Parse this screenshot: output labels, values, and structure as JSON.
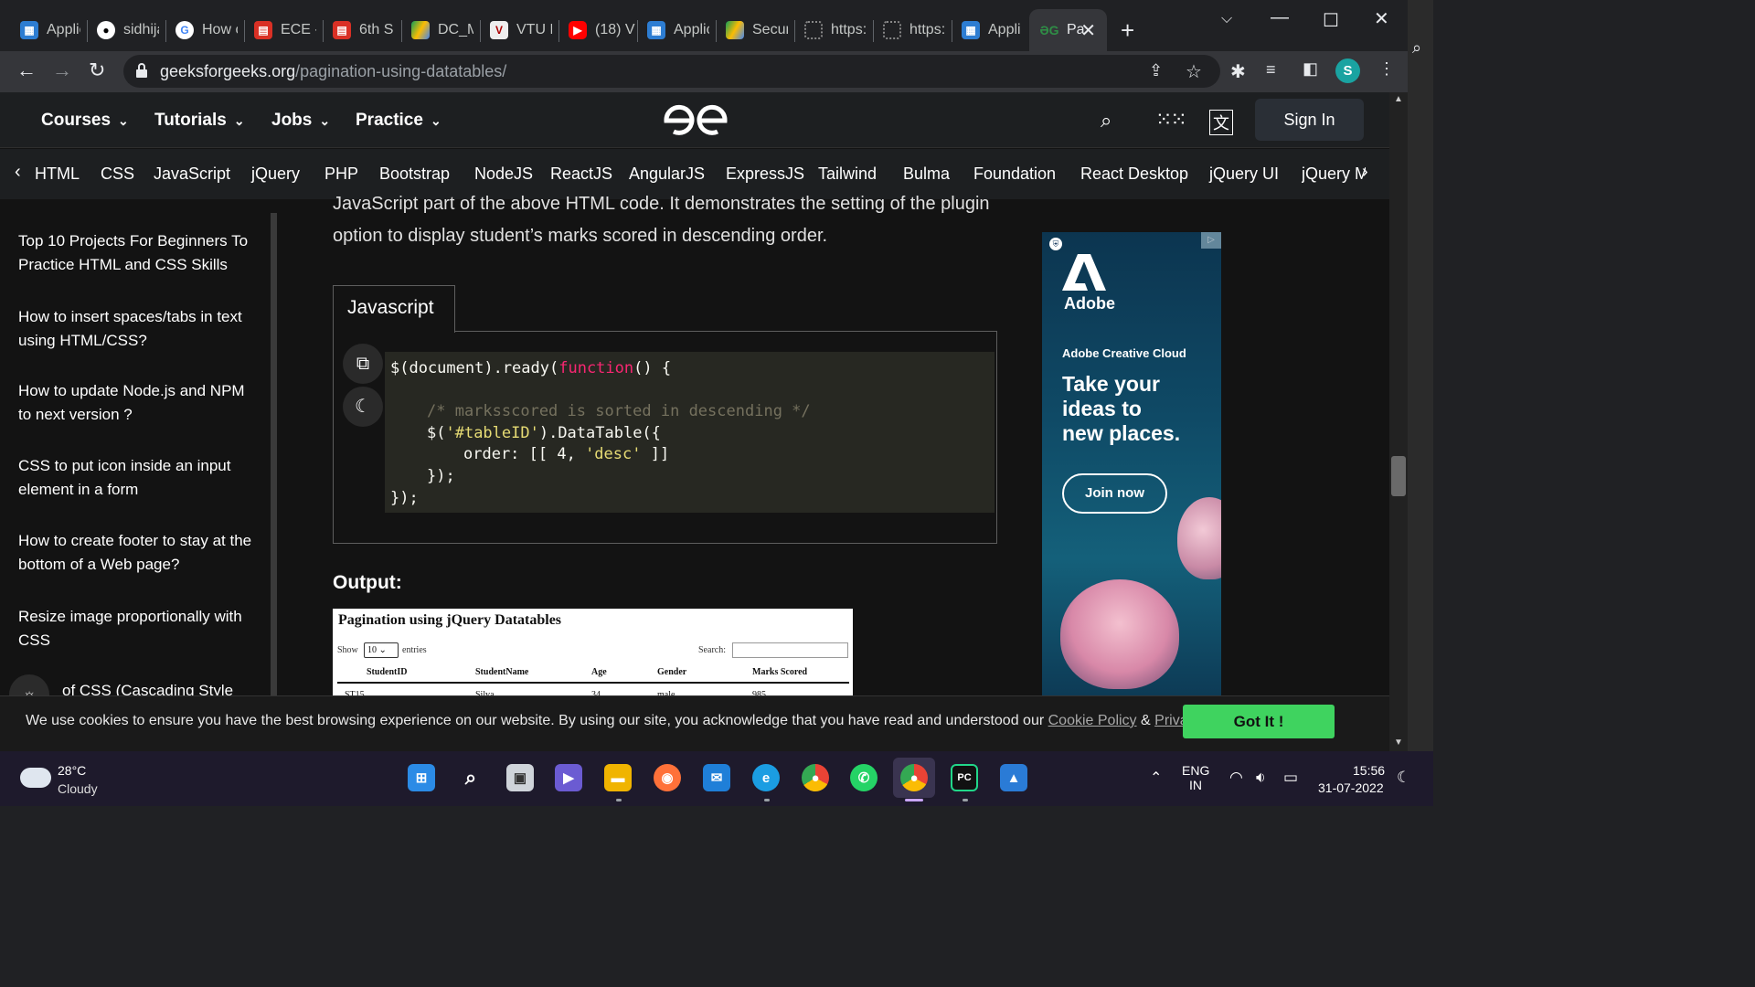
{
  "tabs": [
    {
      "title": "Applic",
      "favicon": "app-icon"
    },
    {
      "title": "sidhija",
      "favicon": "github-icon"
    },
    {
      "title": "How c",
      "favicon": "google-icon"
    },
    {
      "title": "ECE -",
      "favicon": "pdf-icon"
    },
    {
      "title": "6th S",
      "favicon": "pdf-icon"
    },
    {
      "title": "DC_M",
      "favicon": "drive-icon"
    },
    {
      "title": "VTU N",
      "favicon": "vtu-icon"
    },
    {
      "title": "(18) V",
      "favicon": "youtube-icon"
    },
    {
      "title": "Applic",
      "favicon": "app-icon"
    },
    {
      "title": "Secur",
      "favicon": "drive-icon"
    },
    {
      "title": "https:",
      "favicon": "loading-icon"
    },
    {
      "title": "https:",
      "favicon": "loading-icon"
    },
    {
      "title": "Appli",
      "favicon": "app-icon"
    },
    {
      "title": "Pa",
      "favicon": "gfg-icon"
    }
  ],
  "omnibox": {
    "domain": "geeksforgeeks.org",
    "path": "/pagination-using-datatables/"
  },
  "profile_initial": "S",
  "header": {
    "nav": [
      "Courses",
      "Tutorials",
      "Jobs",
      "Practice"
    ],
    "signin": "Sign In"
  },
  "subnav": [
    "HTML",
    "CSS",
    "JavaScript",
    "jQuery",
    "PHP",
    "Bootstrap",
    "NodeJS",
    "ReactJS",
    "AngularJS",
    "ExpressJS",
    "Tailwind",
    "Bulma",
    "Foundation",
    "React Desktop",
    "jQuery UI",
    "jQuery M"
  ],
  "sidebar": [
    "Top 10 Projects For Beginners To Practice HTML and CSS Skills",
    "How to insert spaces/tabs in text using HTML/CSS?",
    "How to update Node.js and NPM to next version ?",
    "CSS to put icon inside an input element in a form",
    "How to create footer to stay at the bottom of a Web page?",
    "Resize image proportionally with CSS",
    "of CSS (Cascading Style"
  ],
  "article": {
    "intro": "JavaScript part of the above HTML code. It demonstrates the setting of the plugin option to display student’s marks scored in descending order.",
    "code_tab": "Javascript",
    "code": {
      "l1_a": "$(document).ready(",
      "l1_kw": "function",
      "l1_b": "() {",
      "l2": "/* marksscored is sorted in descending */",
      "l3_a": "$(",
      "l3_s": "'#tableID'",
      "l3_b": ").DataTable({",
      "l4_a": "order: [[ 4, ",
      "l4_s": "'desc'",
      "l4_b": " ]]",
      "l5": "});",
      "l6": "});"
    },
    "output_label": "Output:",
    "output_image": {
      "title": "Pagination using jQuery Datatables",
      "show": "Show",
      "entries_value": "10",
      "entries": "entries",
      "search": "Search:",
      "columns": [
        "StudentID",
        "StudentName",
        "Age",
        "Gender",
        "Marks Scored"
      ],
      "first_row": [
        "ST15",
        "Silva",
        "34",
        "male",
        "985"
      ]
    }
  },
  "ad": {
    "brand": "Adobe",
    "product": "Adobe Creative Cloud",
    "headline_1": "Take your",
    "headline_2": "ideas to",
    "headline_3": "new places.",
    "cta": "Join now"
  },
  "cookie": {
    "message": "We use cookies to ensure you have the best browsing experience on our website. By using our site, you acknowledge that you have read and understood our",
    "cookie_policy": "Cookie Policy",
    "amp": "&",
    "privacy_policy": "Privacy Policy",
    "button": "Got It !"
  },
  "taskbar": {
    "weather_temp": "28°C",
    "weather_desc": "Cloudy",
    "lang_1": "ENG",
    "lang_2": "IN",
    "time": "15:56",
    "date": "31-07-2022"
  },
  "colors": {
    "accent_green": "#3fd35f",
    "code_keyword": "#f92672",
    "code_string": "#e6db74",
    "code_comment": "#75715e"
  }
}
